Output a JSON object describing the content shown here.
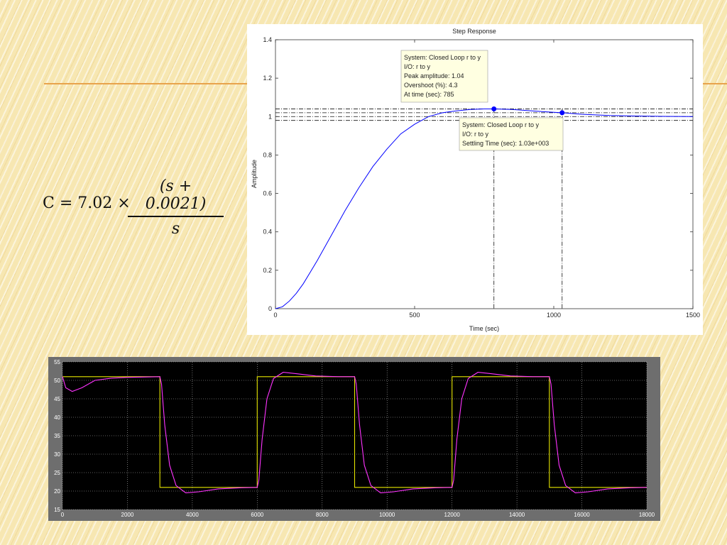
{
  "equation": {
    "lhs": "C = 7.02 ×",
    "numerator": "(s + 0.0021)",
    "denominator": "s"
  },
  "chart_data": [
    {
      "type": "line",
      "title": "Step Response",
      "xlabel": "Time (sec)",
      "ylabel": "Amplitude",
      "xlim": [
        0,
        1500
      ],
      "ylim": [
        0,
        1.4
      ],
      "xticks": [
        "0",
        "500",
        "1000",
        "1500"
      ],
      "yticks": [
        "0",
        "0.2",
        "0.4",
        "0.6",
        "0.8",
        "1",
        "1.2",
        "1.4"
      ],
      "grid": false,
      "series": [
        {
          "color": "#0000ff",
          "x": [
            0,
            25,
            50,
            75,
            100,
            125,
            150,
            200,
            250,
            300,
            350,
            400,
            450,
            500,
            550,
            600,
            650,
            700,
            750,
            785,
            850,
            900,
            950,
            1000,
            1030,
            1100,
            1200,
            1300,
            1400,
            1500
          ],
          "y": [
            0,
            0.01,
            0.04,
            0.08,
            0.13,
            0.19,
            0.25,
            0.38,
            0.51,
            0.63,
            0.74,
            0.83,
            0.91,
            0.96,
            1.0,
            1.02,
            1.03,
            1.037,
            1.04,
            1.04,
            1.037,
            1.032,
            1.027,
            1.022,
            1.02,
            1.012,
            1.006,
            1.003,
            1.001,
            1.0
          ]
        }
      ],
      "reference_lines": {
        "horizontal": [
          1.04,
          1.02,
          1.0,
          0.98
        ],
        "vertical": [
          785,
          1030
        ]
      },
      "markers": [
        {
          "x": 785,
          "y": 1.04,
          "color": "#0000ff"
        },
        {
          "x": 1030,
          "y": 1.02,
          "color": "#0000ff"
        }
      ],
      "annotations": [
        {
          "lines": [
            "System: Closed Loop r to y",
            "I/O: r to y",
            "Peak amplitude: 1.04",
            "Overshoot (%): 4.3",
            "At time (sec): 785"
          ]
        },
        {
          "lines": [
            "System: Closed Loop r to y",
            "I/O: r to y",
            "Settling Time (sec): 1.03e+003"
          ]
        }
      ]
    },
    {
      "type": "line",
      "title": "",
      "xlabel": "",
      "ylabel": "",
      "xlim": [
        0,
        18000
      ],
      "ylim": [
        15,
        55
      ],
      "xticks": [
        "0",
        "2000",
        "4000",
        "6000",
        "8000",
        "10000",
        "12000",
        "14000",
        "16000",
        "18000"
      ],
      "yticks": [
        "15",
        "20",
        "25",
        "30",
        "35",
        "40",
        "45",
        "50",
        "55"
      ],
      "grid": true,
      "background": "#000000",
      "series": [
        {
          "color": "#e5e500",
          "x": [
            0,
            3000,
            3000,
            6000,
            6000,
            9000,
            9000,
            12000,
            12000,
            15000,
            15000,
            18000
          ],
          "y": [
            51,
            51,
            21,
            21,
            51,
            51,
            21,
            21,
            51,
            51,
            21,
            21
          ]
        },
        {
          "color": "#ff33ff",
          "x": [
            0,
            100,
            300,
            600,
            1000,
            1500,
            2000,
            2500,
            3000,
            3050,
            3150,
            3300,
            3500,
            3800,
            4200,
            4800,
            5500,
            6000,
            6050,
            6150,
            6300,
            6500,
            6800,
            7200,
            7800,
            8500,
            9000,
            9050,
            9150,
            9300,
            9500,
            9800,
            10200,
            10800,
            11500,
            12000,
            12050,
            12150,
            12300,
            12500,
            12800,
            13200,
            13800,
            14500,
            15000,
            15050,
            15150,
            15300,
            15500,
            15800,
            16200,
            16800,
            17500,
            18000
          ],
          "y": [
            51,
            48,
            47,
            48,
            50,
            50.6,
            50.8,
            50.9,
            51,
            49,
            38,
            27,
            21.5,
            19.5,
            19.8,
            20.6,
            20.9,
            21,
            23,
            34,
            45,
            50.5,
            52.2,
            51.8,
            51.2,
            51,
            51,
            49,
            38,
            27,
            21.5,
            19.5,
            19.8,
            20.6,
            20.9,
            21,
            23,
            34,
            45,
            50.5,
            52.2,
            51.8,
            51.2,
            51,
            51,
            49,
            38,
            27,
            21.5,
            19.5,
            19.8,
            20.6,
            20.9,
            21
          ]
        }
      ]
    }
  ]
}
